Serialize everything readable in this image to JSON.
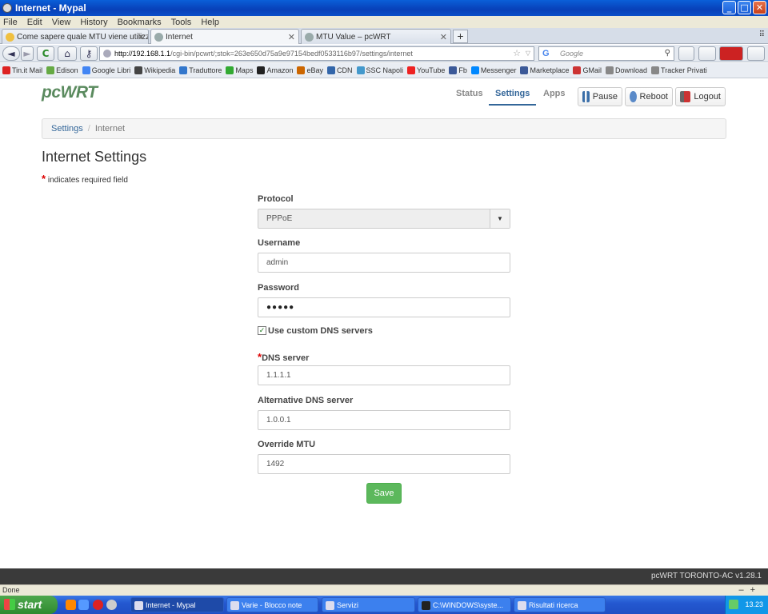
{
  "window": {
    "title": "Internet - Mypal",
    "buttons": [
      "_",
      "□",
      "✕"
    ]
  },
  "menu": [
    "File",
    "Edit",
    "View",
    "History",
    "Bookmarks",
    "Tools",
    "Help"
  ],
  "tabs": [
    {
      "label": "Come sapere quale MTU viene utilizzato i...",
      "close": "✕"
    },
    {
      "label": "Internet",
      "close": "✕"
    },
    {
      "label": "MTU Value – pcWRT",
      "close": "✕"
    }
  ],
  "newtab_label": "+",
  "tablist_label": "⠿",
  "nav": {
    "back": "◄",
    "forward": "►",
    "reload": "C",
    "home": "⌂",
    "key": "⚷",
    "url_host": "http://192.168.1.1",
    "url_path": "/cgi-bin/pcwrt/;stok=263e650d75a9e97154bedf0533116b97/settings/internet",
    "url_star": "☆",
    "url_drop": "▽",
    "search_engine": "G",
    "search_placeholder": "Google",
    "search_icon": "⚲"
  },
  "bookmarks": [
    "Tin.it Mail",
    "Edison",
    "Google Libri",
    "Wikipedia",
    "Traduttore",
    "Maps",
    "Amazon",
    "eBay",
    "CDN",
    "SSC Napoli",
    "YouTube",
    "Fb",
    "Messenger",
    "Marketplace",
    "GMail",
    "Download",
    "Tracker Privati"
  ],
  "bookmark_colors": [
    "#d22",
    "#6a4",
    "#4285f4",
    "#444",
    "#37c",
    "#3a3",
    "#222",
    "#c60",
    "#36a",
    "#49c",
    "#e22",
    "#3b5998",
    "#08f",
    "#3b5998",
    "#c33",
    "#888",
    "#888"
  ],
  "app": {
    "logo": "pcWRT",
    "nav_items": [
      {
        "label": "Status"
      },
      {
        "label": "Settings"
      },
      {
        "label": "Apps"
      }
    ],
    "buttons": {
      "pause": "Pause",
      "reboot": "Reboot",
      "logout": "Logout"
    },
    "breadcrumb": {
      "root": "Settings",
      "sep": "/",
      "current": "Internet"
    },
    "title": "Internet Settings",
    "required_star": "*",
    "required_note": "indicates required field",
    "form": {
      "protocol_label": "Protocol",
      "protocol_value": "PPPoE",
      "protocol_caret": "▼",
      "username_label": "Username",
      "username_value": "admin",
      "password_label": "Password",
      "password_value": "●●●●●",
      "dns_checkbox_label": "Use custom DNS servers",
      "dns_checkbox_mark": "✓",
      "dns_checked": true,
      "dns_label": "DNS server",
      "dns_value": "1.1.1.1",
      "alt_dns_label": "Alternative DNS server",
      "alt_dns_value": "1.0.0.1",
      "mtu_label": "Override MTU",
      "mtu_value": "1492",
      "save_label": "Save"
    },
    "footer": "pcWRT TORONTO-AC v1.28.1"
  },
  "status_text": "Done",
  "zoom": {
    "minus": "–",
    "plus": "+"
  },
  "taskbar": {
    "start": "start",
    "tasks": [
      "Internet - Mypal",
      "Varie - Blocco note",
      "Servizi",
      "C:\\WINDOWS\\syste...",
      "Risultati ricerca"
    ],
    "clock": "13.23"
  },
  "colors": {
    "accent": "#336699",
    "save": "#5cb85c",
    "logo": "#5a8a5e",
    "required": "#dd0000"
  }
}
